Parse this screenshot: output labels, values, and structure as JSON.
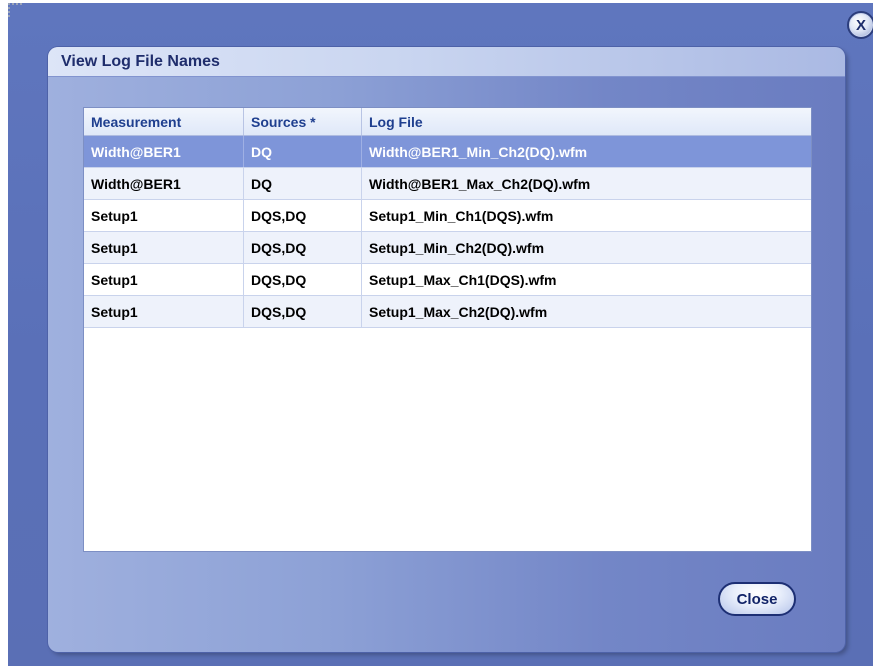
{
  "dialog": {
    "title": "View Log File Names",
    "close_label": "Close",
    "close_x_label": "X"
  },
  "table": {
    "headers": [
      "Measurement",
      "Sources *",
      "Log File"
    ],
    "rows": [
      [
        "Width@BER1",
        "DQ",
        "Width@BER1_Min_Ch2(DQ).wfm"
      ],
      [
        "Width@BER1",
        "DQ",
        "Width@BER1_Max_Ch2(DQ).wfm"
      ],
      [
        "Setup1",
        "DQS,DQ",
        "Setup1_Min_Ch1(DQS).wfm"
      ],
      [
        "Setup1",
        "DQS,DQ",
        "Setup1_Min_Ch2(DQ).wfm"
      ],
      [
        "Setup1",
        "DQS,DQ",
        "Setup1_Max_Ch1(DQS).wfm"
      ],
      [
        "Setup1",
        "DQS,DQ",
        "Setup1_Max_Ch2(DQ).wfm"
      ]
    ],
    "selected_row": 0
  },
  "colors": {
    "background": "#5a70b8",
    "title_text": "#1f2d6c",
    "header_text": "#1f3f8f",
    "selected_row": "#7e95d9"
  }
}
